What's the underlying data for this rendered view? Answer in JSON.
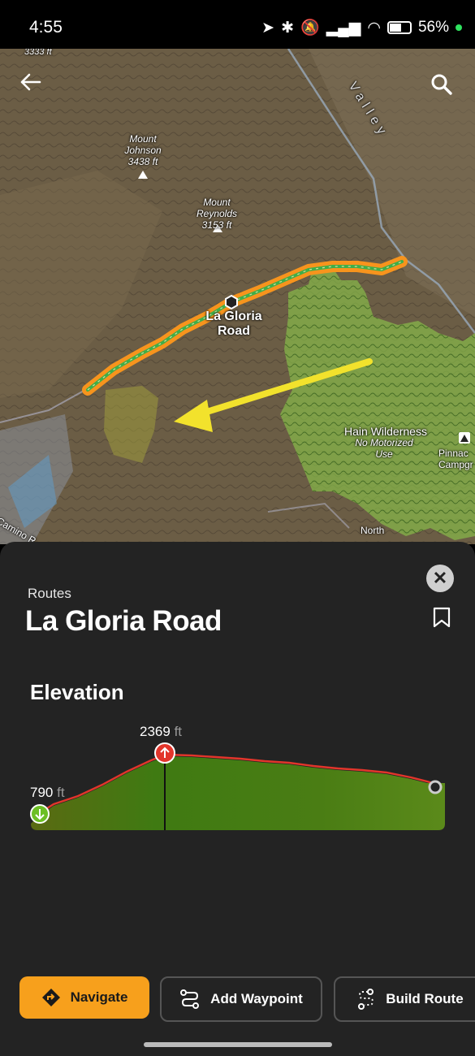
{
  "status_bar": {
    "time": "4:55",
    "battery": "56%"
  },
  "map": {
    "labels": {
      "top_peak": "3333 ft",
      "mount_johnson_name": "Mount Johnson",
      "mount_johnson_elev": "3438 ft",
      "mount_reynolds_name": "Mount Reynolds",
      "mount_reynolds_elev": "3153 ft",
      "valley": "Valley",
      "route_name": "La Gloria Road",
      "wilderness_name": "Hain Wilderness",
      "wilderness_note": "No Motorized Use",
      "pinnacles": "Pinnac Campgr",
      "north": "North",
      "camino": "Camino R"
    },
    "colors": {
      "route_outline": "#f7941d",
      "route_inner": "#3fae49",
      "wilderness": "#8bc34a",
      "arrow": "#f2e22c"
    }
  },
  "sheet": {
    "category": "Routes",
    "title": "La Gloria Road",
    "elevation_heading": "Elevation",
    "max_elevation": "2369",
    "min_elevation": "790",
    "unit": "ft"
  },
  "actions": {
    "navigate": "Navigate",
    "add_waypoint": "Add Waypoint",
    "build_route": "Build Route"
  }
}
